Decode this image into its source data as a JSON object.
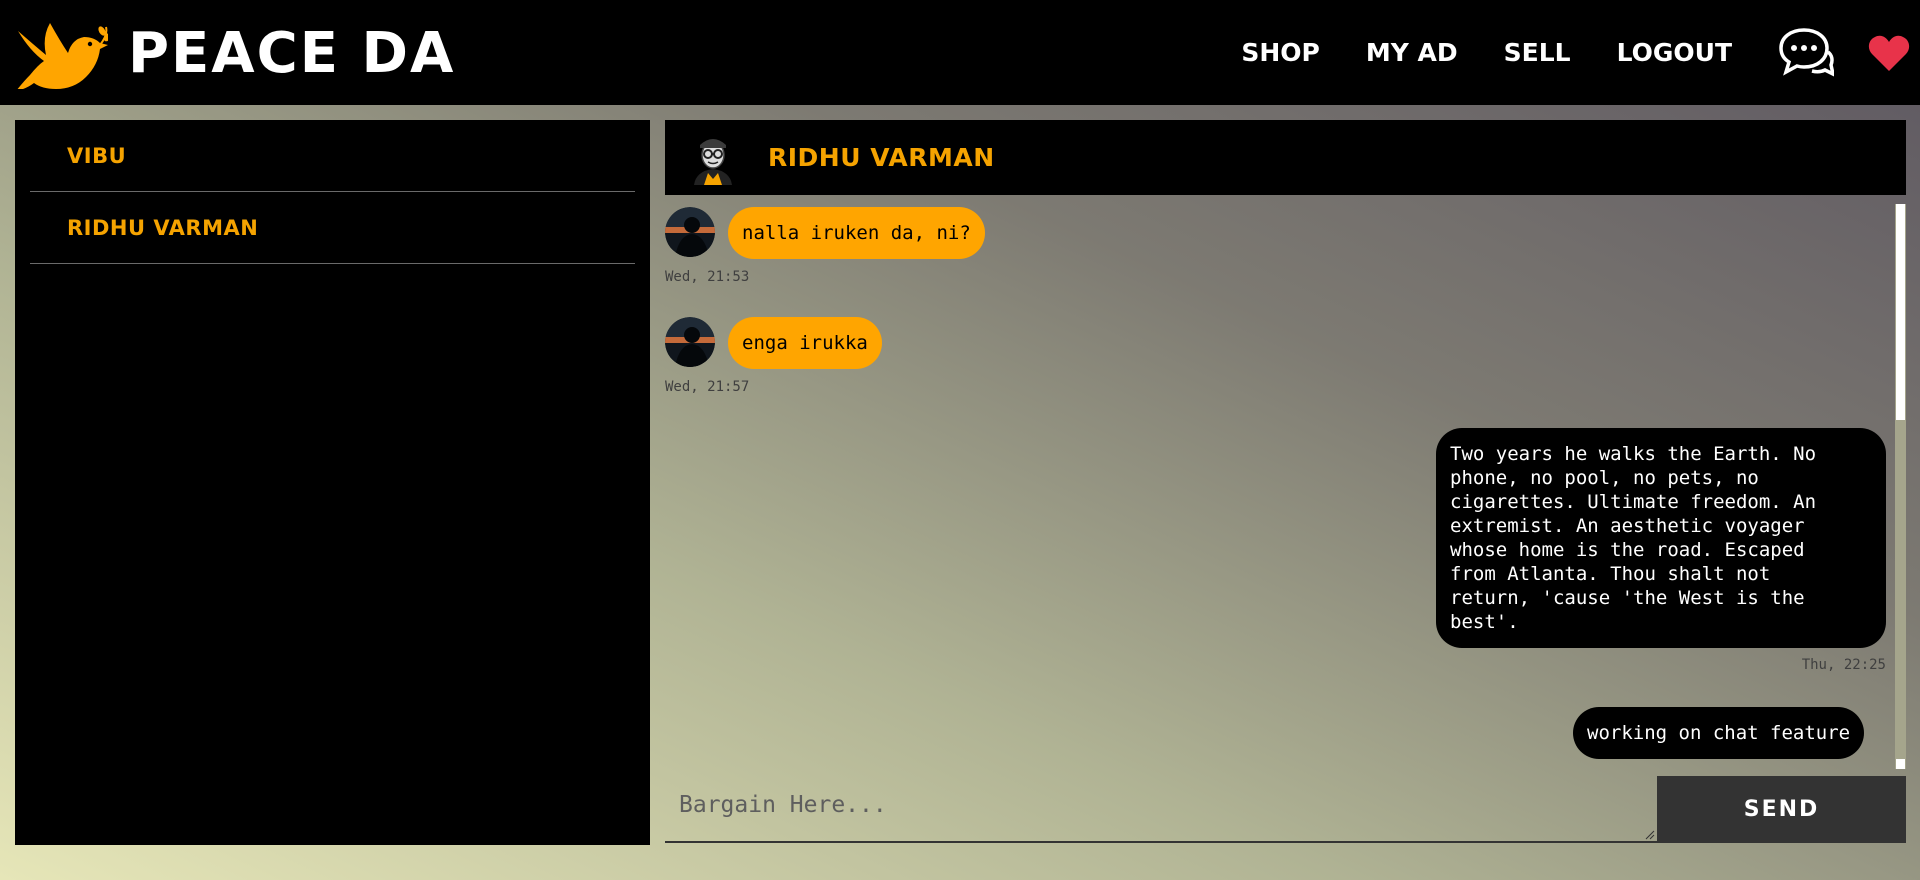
{
  "brand": {
    "name": "PEACE DA",
    "logo_icon": "dove-icon",
    "accent": "#ffa500"
  },
  "nav": {
    "links": [
      "SHOP",
      "MY AD",
      "SELL",
      "LOGOUT"
    ],
    "chat_icon": "chat-bubbles-icon",
    "heart_icon": "heart-icon",
    "heart_color": "#e8334a"
  },
  "sidebar": {
    "contacts": [
      {
        "label": "VIBU"
      },
      {
        "label": "RIDHU VARMAN"
      }
    ]
  },
  "chat": {
    "header_name": "RIDHU VARMAN",
    "messages": [
      {
        "direction": "incoming",
        "text": "nalla iruken da, ni?",
        "time": "Wed, 21:53"
      },
      {
        "direction": "incoming",
        "text": "enga irukka",
        "time": "Wed, 21:57"
      },
      {
        "direction": "outgoing",
        "text": "Two years he walks the Earth. No phone, no pool, no pets, no cigarettes. Ultimate freedom. An extremist. An aesthetic voyager whose home is the road. Escaped from Atlanta. Thou shalt not return, 'cause 'the West is the best'.",
        "lines": [
          "Two years he walks the Earth. No",
          "phone, no pool, no pets, no",
          "cigarettes. Ultimate freedom. An",
          "extremist. An aesthetic voyager",
          "whose home is the road. Escaped",
          "from Atlanta. Thou shalt not",
          "return, 'cause 'the West is the",
          "best'."
        ],
        "time": "Thu, 22:25"
      },
      {
        "direction": "outgoing",
        "text": "working on chat feature"
      }
    ]
  },
  "input": {
    "placeholder": "Bargain Here...",
    "value": ""
  },
  "send_button": {
    "label": "SEND"
  }
}
